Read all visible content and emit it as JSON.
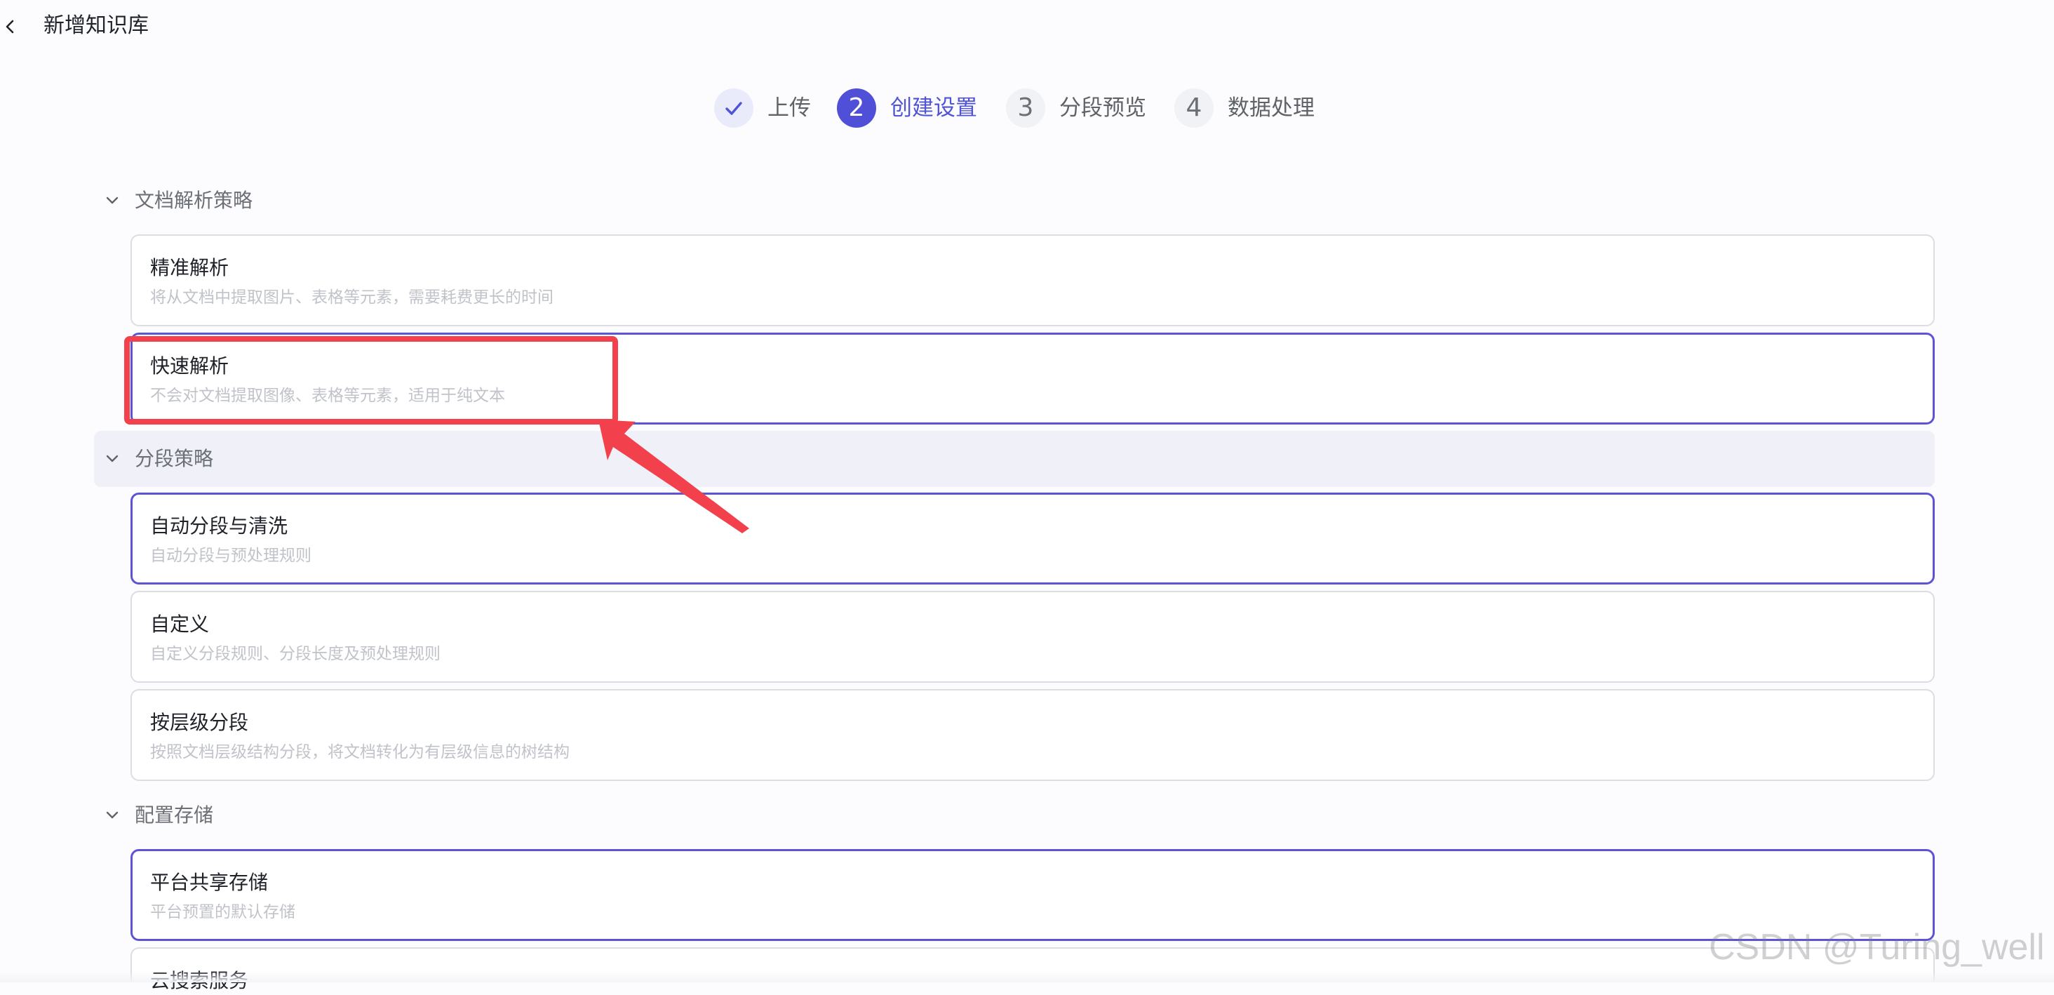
{
  "header": {
    "title": "新增知识库"
  },
  "steps": [
    {
      "marker": "",
      "label": "上传",
      "state": "done"
    },
    {
      "marker": "2",
      "label": "创建设置",
      "state": "active"
    },
    {
      "marker": "3",
      "label": "分段预览",
      "state": "pending"
    },
    {
      "marker": "4",
      "label": "数据处理",
      "state": "pending"
    }
  ],
  "sections": {
    "parsing": {
      "title": "文档解析策略",
      "options": [
        {
          "title": "精准解析",
          "desc": "将从文档中提取图片、表格等元素，需要耗费更长的时间",
          "selected": false
        },
        {
          "title": "快速解析",
          "desc": "不会对文档提取图像、表格等元素，适用于纯文本",
          "selected": true
        }
      ]
    },
    "segmentation": {
      "title": "分段策略",
      "options": [
        {
          "title": "自动分段与清洗",
          "desc": "自动分段与预处理规则",
          "selected": true
        },
        {
          "title": "自定义",
          "desc": "自定义分段规则、分段长度及预处理规则",
          "selected": false
        },
        {
          "title": "按层级分段",
          "desc": "按照文档层级结构分段，将文档转化为有层级信息的树结构",
          "selected": false
        }
      ]
    },
    "storage": {
      "title": "配置存储",
      "options": [
        {
          "title": "平台共享存储",
          "desc": "平台预置的默认存储",
          "selected": true
        },
        {
          "title": "云搜索服务",
          "desc": "",
          "selected": false
        }
      ]
    }
  },
  "colors": {
    "accent": "#4f4fd8",
    "annotation": "#f2404c"
  },
  "watermark": "CSDN @Turing_well"
}
